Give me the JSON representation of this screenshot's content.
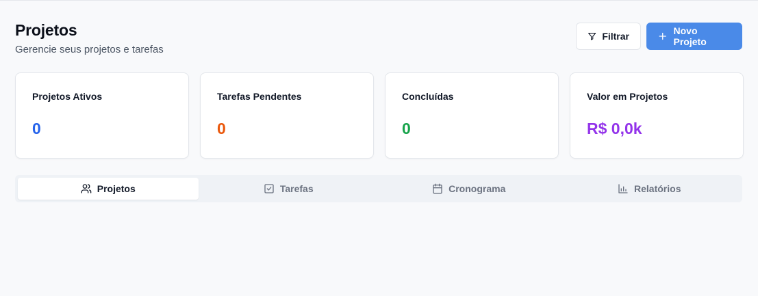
{
  "header": {
    "title": "Projetos",
    "subtitle": "Gerencie seus projetos e tarefas"
  },
  "actions": {
    "filter_label": "Filtrar",
    "new_project_label": "Novo Projeto"
  },
  "stats": [
    {
      "label": "Projetos Ativos",
      "value": "0",
      "color": "#2563eb"
    },
    {
      "label": "Tarefas Pendentes",
      "value": "0",
      "color": "#ea580c"
    },
    {
      "label": "Concluídas",
      "value": "0",
      "color": "#16a34a"
    },
    {
      "label": "Valor em Projetos",
      "value": "R$ 0,0k",
      "color": "#9333ea"
    }
  ],
  "tabs": [
    {
      "label": "Projetos",
      "icon": "users-icon",
      "active": true
    },
    {
      "label": "Tarefas",
      "icon": "check-square-icon",
      "active": false
    },
    {
      "label": "Cronograma",
      "icon": "calendar-icon",
      "active": false
    },
    {
      "label": "Relatórios",
      "icon": "bar-chart-icon",
      "active": false
    }
  ]
}
